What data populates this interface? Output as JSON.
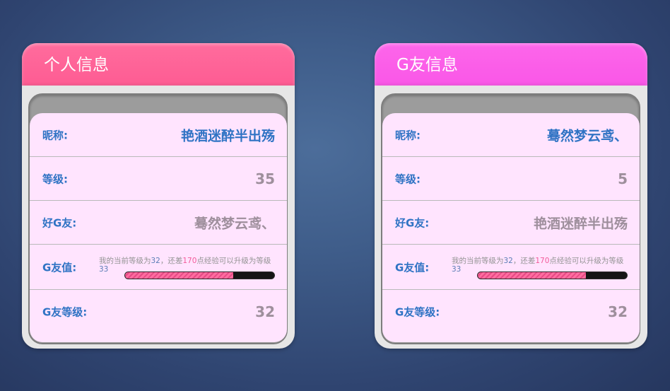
{
  "panels": [
    {
      "title": "个人信息",
      "nickname_label": "昵称:",
      "nickname": "艳酒迷醉半出殇",
      "level_label": "等级:",
      "level": "35",
      "best_friend_label": "好G友:",
      "best_friend": "蓦然梦云鸢、",
      "g_value_label": "G友值:",
      "g_note_prefix": "我的当前等级为",
      "g_note_current": "32",
      "g_note_mid": "，还差",
      "g_note_exp": "170",
      "g_note_suffix": "点经验可以升级为等级",
      "g_note_next": "33",
      "g_progress": 0.73,
      "g_level_label": "G友等级:",
      "g_level": "32",
      "header_color": "#fe5c93"
    },
    {
      "title": "G友信息",
      "nickname_label": "昵称:",
      "nickname": "蓦然梦云鸢、",
      "level_label": "等级:",
      "level": "5",
      "best_friend_label": "好G友:",
      "best_friend": "艳酒迷醉半出殇",
      "g_value_label": "G友值:",
      "g_note_prefix": "我的当前等级为",
      "g_note_current": "32",
      "g_note_mid": "，还差",
      "g_note_exp": "170",
      "g_note_suffix": "点经验可以升级为等级",
      "g_note_next": "33",
      "g_progress": 0.73,
      "g_level_label": "G友等级:",
      "g_level": "32",
      "header_color": "#f957e7"
    }
  ]
}
